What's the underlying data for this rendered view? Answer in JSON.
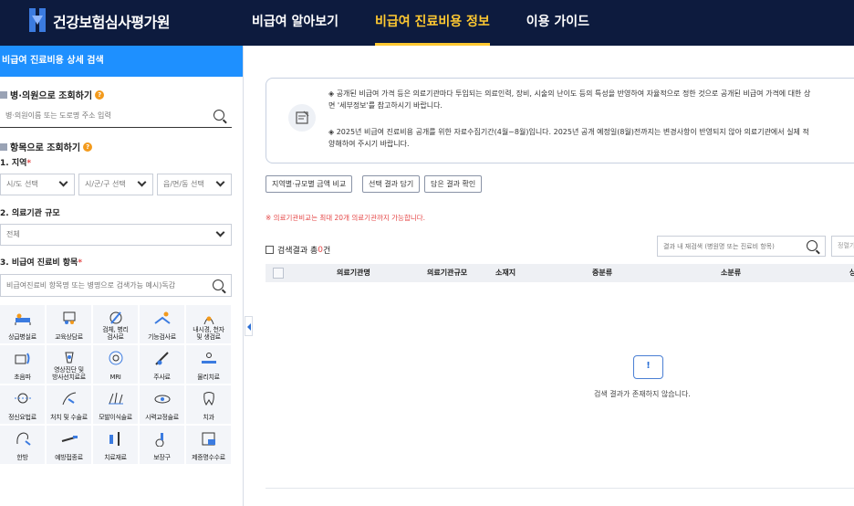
{
  "header": {
    "logo_text": "건강보험심사평가원",
    "nav": [
      "비급여 알아보기",
      "비급여 진료비용 정보",
      "이용 가이드"
    ],
    "active_nav": "비급여 진료비용 정보",
    "colors": {
      "bg": "#0d1b3e",
      "active": "#ffc931"
    }
  },
  "sidebar": {
    "title": "비급여 진료비용 상세 검색",
    "hospital_search": {
      "title": "병·의원으로 조회하기",
      "help_icon": "question-icon",
      "placeholder": "병·의원이름 또는 도로명 주소 입력"
    },
    "item_search": {
      "title": "항목으로 조회하기",
      "region_label": "1. 지역",
      "region_selects": [
        "시/도 선택",
        "시/군/구 선택",
        "읍/면/동 선택"
      ],
      "scale_label": "2. 의료기관 규모",
      "scale_value": "전체",
      "item_label": "3. 비급여 진료비 항목",
      "item_placeholder": "비급여진료비 항목명 또는 병명으로 검색가능 예시)독감",
      "required_mark": "*"
    },
    "categories": [
      {
        "label": "상급병실료",
        "icon": "hospital-bed-icon"
      },
      {
        "label": "교육상담료",
        "icon": "consultation-icon"
      },
      {
        "label": "검체, 병리\n검사료",
        "icon": "specimen-test-icon"
      },
      {
        "label": "기능검사료",
        "icon": "function-test-icon"
      },
      {
        "label": "내시경, 천자\n및 생검료",
        "icon": "endoscope-icon"
      },
      {
        "label": "초음파",
        "icon": "ultrasound-icon"
      },
      {
        "label": "영상진단 및\n방사선치료료",
        "icon": "radiology-icon"
      },
      {
        "label": "MRI",
        "icon": "mri-icon"
      },
      {
        "label": "주사료",
        "icon": "injection-icon"
      },
      {
        "label": "물리치료",
        "icon": "physical-therapy-icon"
      },
      {
        "label": "정신요법료",
        "icon": "psychotherapy-icon"
      },
      {
        "label": "처치 및 수술료",
        "icon": "surgery-icon"
      },
      {
        "label": "모발이식술료",
        "icon": "hair-transplant-icon"
      },
      {
        "label": "시력교정술료",
        "icon": "vision-correction-icon"
      },
      {
        "label": "치과",
        "icon": "tooth-icon"
      },
      {
        "label": "한방",
        "icon": "oriental-medicine-icon"
      },
      {
        "label": "예방접종료",
        "icon": "vaccination-icon"
      },
      {
        "label": "치료재료",
        "icon": "treatment-material-icon"
      },
      {
        "label": "보장구",
        "icon": "wheelchair-icon"
      },
      {
        "label": "제증명수수료",
        "icon": "certificate-icon"
      }
    ]
  },
  "notice": {
    "line1": "◈ 공개된 비급여 가격 등은 의료기관마다 투입되는 의료인력, 장비, 시술의 난이도 등의 특성을 반영하여 자율적으로 정한 것으로 공개된 비급여 가격에 대한 상",
    "line2": "면 '세부정보'를 참고하시기 바랍니다.",
    "line3": "◈ 2025년 비급여 진료비용 공개를 위한 자료수집기간(4월~8월)입니다. 2025년 공개 예정일(8월)전까지는 변경사항이 반영되지 않아 의료기관에서 실제 적",
    "line4": "양해하여 주시기 바랍니다."
  },
  "actions": [
    "지역별·규모별 금액 비교",
    "선택 결과 담기",
    "담은 결과 확인"
  ],
  "warning": "※ 의료기관비교는 최대 20개 의료기관까지 가능합니다.",
  "results": {
    "title_prefix": "검색결과 총",
    "count": "0",
    "title_suffix": "건",
    "search_placeholder": "결과 내 재검색 (병원명 또는 진료비 항목)",
    "sort_label": "정렬기",
    "columns": [
      "의료기관명",
      "의료기관규모",
      "소재지",
      "중분류",
      "소분류",
      "상"
    ],
    "empty_text": "검색 결과가 존재하지 않습니다.",
    "empty_icon_glyph": "!"
  }
}
